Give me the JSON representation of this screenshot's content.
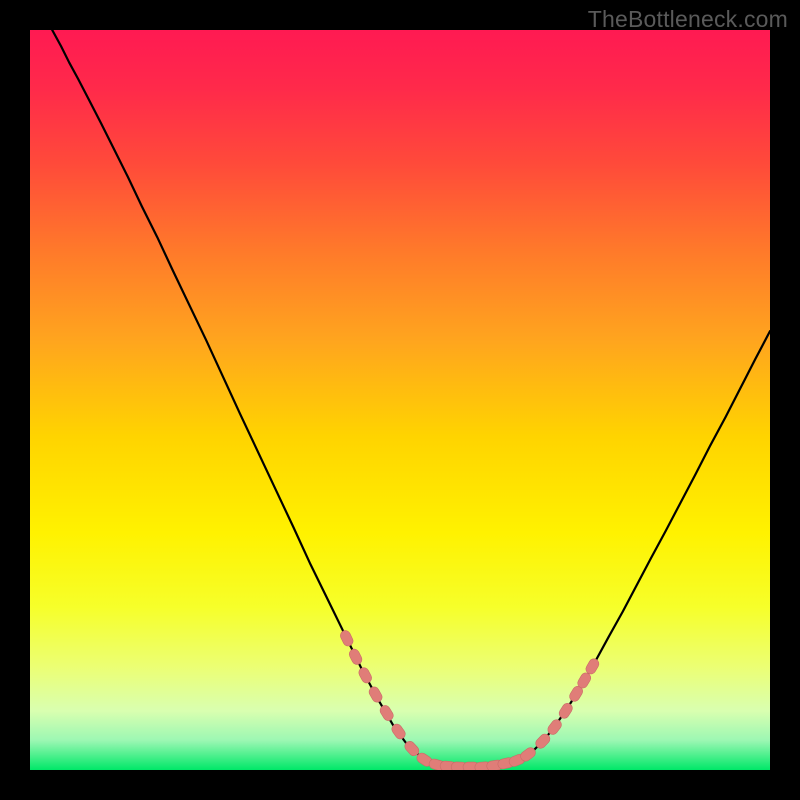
{
  "watermark": "TheBottleneck.com",
  "colors": {
    "background": "#000000",
    "gradient_top": "#ff1a52",
    "gradient_mid": "#ffd400",
    "gradient_bottom": "#00e868",
    "curve": "#000000",
    "marker_fill": "#e07d78",
    "marker_stroke": "#c96c67"
  },
  "chart_data": {
    "type": "line",
    "title": "",
    "xlabel": "",
    "ylabel": "",
    "xlim": [
      0,
      100
    ],
    "ylim": [
      0,
      100
    ],
    "grid": false,
    "legend": false,
    "curve": [
      {
        "x": 3.0,
        "y": 100.0
      },
      {
        "x": 4.2,
        "y": 97.8
      },
      {
        "x": 5.3,
        "y": 95.6
      },
      {
        "x": 6.5,
        "y": 93.4
      },
      {
        "x": 8.0,
        "y": 90.5
      },
      {
        "x": 9.6,
        "y": 87.4
      },
      {
        "x": 11.3,
        "y": 84.0
      },
      {
        "x": 13.2,
        "y": 80.2
      },
      {
        "x": 15.1,
        "y": 76.2
      },
      {
        "x": 17.2,
        "y": 72.0
      },
      {
        "x": 19.3,
        "y": 67.5
      },
      {
        "x": 21.5,
        "y": 62.9
      },
      {
        "x": 23.8,
        "y": 58.1
      },
      {
        "x": 26.1,
        "y": 53.1
      },
      {
        "x": 28.4,
        "y": 48.1
      },
      {
        "x": 30.8,
        "y": 43.0
      },
      {
        "x": 33.2,
        "y": 37.9
      },
      {
        "x": 35.6,
        "y": 32.8
      },
      {
        "x": 37.9,
        "y": 27.8
      },
      {
        "x": 40.3,
        "y": 22.9
      },
      {
        "x": 42.6,
        "y": 18.2
      },
      {
        "x": 44.8,
        "y": 13.7
      },
      {
        "x": 47.0,
        "y": 9.6
      },
      {
        "x": 49.1,
        "y": 6.0
      },
      {
        "x": 51.0,
        "y": 3.4
      },
      {
        "x": 52.8,
        "y": 1.8
      },
      {
        "x": 54.5,
        "y": 0.9
      },
      {
        "x": 56.0,
        "y": 0.5
      },
      {
        "x": 57.5,
        "y": 0.4
      },
      {
        "x": 59.0,
        "y": 0.4
      },
      {
        "x": 60.5,
        "y": 0.4
      },
      {
        "x": 62.0,
        "y": 0.5
      },
      {
        "x": 63.5,
        "y": 0.7
      },
      {
        "x": 65.0,
        "y": 1.0
      },
      {
        "x": 66.5,
        "y": 1.6
      },
      {
        "x": 68.0,
        "y": 2.6
      },
      {
        "x": 69.6,
        "y": 4.2
      },
      {
        "x": 71.2,
        "y": 6.3
      },
      {
        "x": 72.9,
        "y": 8.8
      },
      {
        "x": 74.6,
        "y": 11.6
      },
      {
        "x": 76.4,
        "y": 14.7
      },
      {
        "x": 78.2,
        "y": 18.0
      },
      {
        "x": 80.1,
        "y": 21.4
      },
      {
        "x": 82.0,
        "y": 25.0
      },
      {
        "x": 83.9,
        "y": 28.6
      },
      {
        "x": 85.9,
        "y": 32.3
      },
      {
        "x": 87.9,
        "y": 36.1
      },
      {
        "x": 89.9,
        "y": 39.9
      },
      {
        "x": 91.9,
        "y": 43.8
      },
      {
        "x": 94.0,
        "y": 47.7
      },
      {
        "x": 96.0,
        "y": 51.6
      },
      {
        "x": 98.0,
        "y": 55.5
      },
      {
        "x": 100.0,
        "y": 59.3
      }
    ],
    "markers": [
      {
        "x": 42.8,
        "y": 17.8
      },
      {
        "x": 44.0,
        "y": 15.3
      },
      {
        "x": 45.3,
        "y": 12.8
      },
      {
        "x": 46.7,
        "y": 10.2
      },
      {
        "x": 48.2,
        "y": 7.7
      },
      {
        "x": 49.8,
        "y": 5.2
      },
      {
        "x": 51.6,
        "y": 2.9
      },
      {
        "x": 53.3,
        "y": 1.4
      },
      {
        "x": 55.0,
        "y": 0.7
      },
      {
        "x": 56.5,
        "y": 0.5
      },
      {
        "x": 58.0,
        "y": 0.4
      },
      {
        "x": 59.6,
        "y": 0.4
      },
      {
        "x": 61.2,
        "y": 0.4
      },
      {
        "x": 62.8,
        "y": 0.6
      },
      {
        "x": 64.3,
        "y": 0.9
      },
      {
        "x": 65.8,
        "y": 1.3
      },
      {
        "x": 67.3,
        "y": 2.1
      },
      {
        "x": 69.3,
        "y": 3.9
      },
      {
        "x": 70.9,
        "y": 5.8
      },
      {
        "x": 72.4,
        "y": 8.0
      },
      {
        "x": 73.8,
        "y": 10.3
      },
      {
        "x": 74.9,
        "y": 12.1
      },
      {
        "x": 76.0,
        "y": 14.0
      }
    ]
  }
}
